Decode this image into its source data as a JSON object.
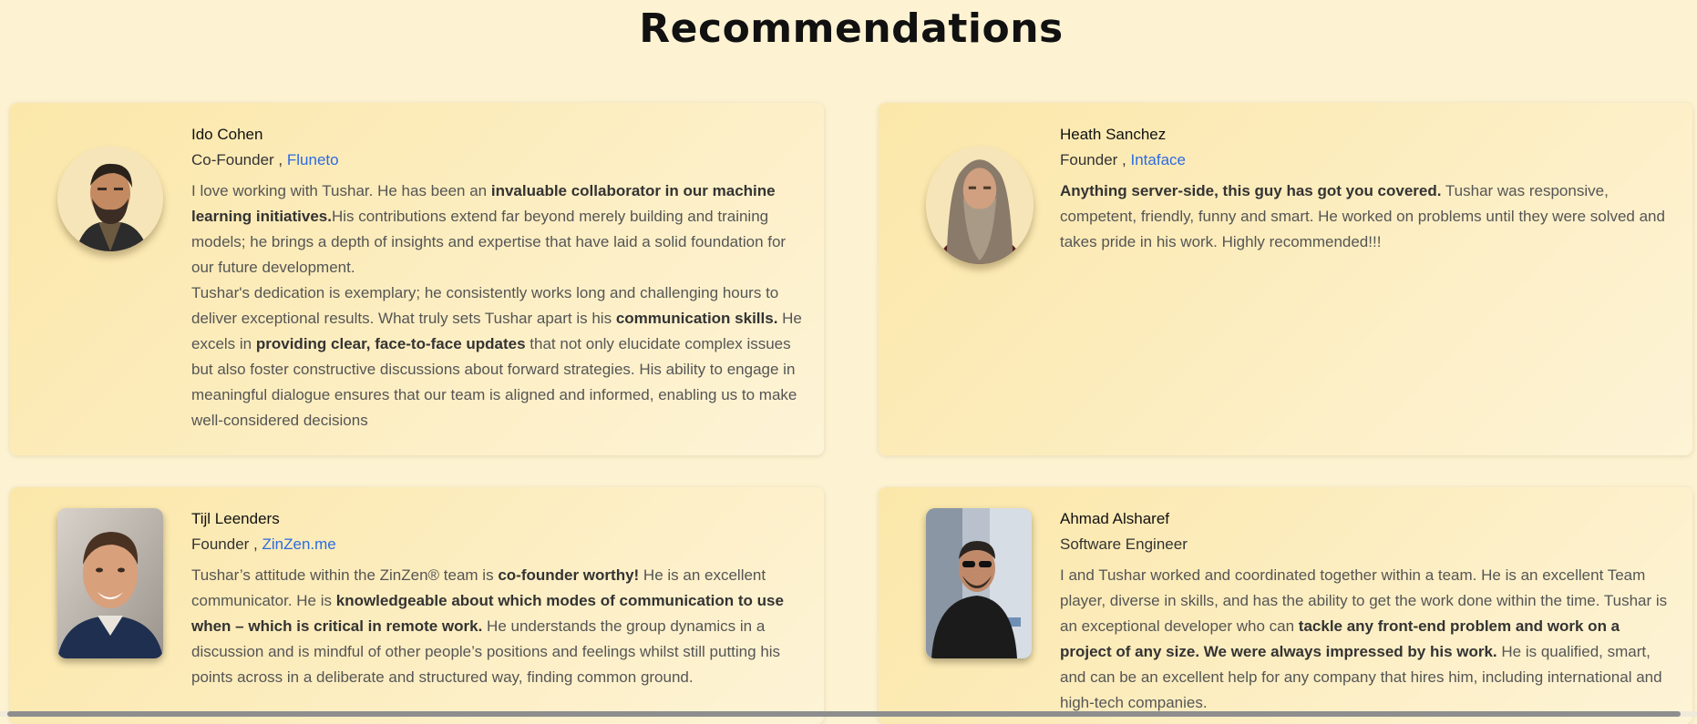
{
  "section_title": "Recommendations",
  "recommendations": [
    {
      "name": "Ido Cohen",
      "role": "Co-Founder , ",
      "company": "Fluneto",
      "avatar_icon": "bearded-man-photo",
      "text": [
        {
          "t": "I love working with Tushar. He has been an "
        },
        {
          "t": "invaluable collaborator in our machine learning initiatives.",
          "b": true
        },
        {
          "t": "His contributions extend far beyond merely building and training models; he brings a depth of insights and expertise that have laid a solid foundation for our future development."
        },
        {
          "br": true
        },
        {
          "t": "Tushar's dedication is exemplary; he consistently works long and challenging hours to deliver exceptional results. What truly sets Tushar apart is his "
        },
        {
          "t": "communication skills.",
          "b": true
        },
        {
          "t": " He excels in "
        },
        {
          "t": "providing clear, face-to-face updates",
          "b": true
        },
        {
          "t": " that not only elucidate complex issues but also foster constructive discussions about forward strategies. His ability to engage in meaningful dialogue ensures that our team is aligned and informed, enabling us to make well-considered decisions"
        }
      ]
    },
    {
      "name": "Heath Sanchez",
      "role": "Founder , ",
      "company": "Intaface",
      "avatar_icon": "long-haired-man-photo",
      "text": [
        {
          "t": "Anything server-side, this guy has got you covered.",
          "b": true
        },
        {
          "t": " Tushar was responsive, competent, friendly, funny and smart. He worked on problems until they were solved and takes pride in his work. Highly recommended!!!"
        }
      ]
    },
    {
      "name": "Tijl Leenders",
      "role": "Founder , ",
      "company": "ZinZen.me",
      "avatar_icon": "smiling-man-photo",
      "text": [
        {
          "t": "Tushar’s attitude within the ZinZen® team is "
        },
        {
          "t": "co-founder worthy!",
          "b": true
        },
        {
          "t": " He is an excellent communicator. He is "
        },
        {
          "t": "knowledgeable about which modes of communication to use when – which is critical in remote work.",
          "b": true
        },
        {
          "t": " He understands the group dynamics in a discussion and is mindful of other people’s positions and feelings whilst still putting his points across in a deliberate and structured way, finding common ground."
        }
      ]
    },
    {
      "name": "Ahmad Alsharef",
      "role": "Software Engineer",
      "company": "",
      "avatar_icon": "man-with-sunglasses-photo",
      "text": [
        {
          "t": "I and Tushar worked and coordinated together within a team. He is an excellent Team player, diverse in skills, and has the ability to get the work done within the time. Tushar is an exceptional developer who can "
        },
        {
          "t": "tackle any front-end problem and work on a project of any size. We were always impressed by his work.",
          "b": true
        },
        {
          "t": " He is qualified, smart, and can be an excellent help for any company that hires him, including international and high-tech companies."
        }
      ]
    }
  ]
}
